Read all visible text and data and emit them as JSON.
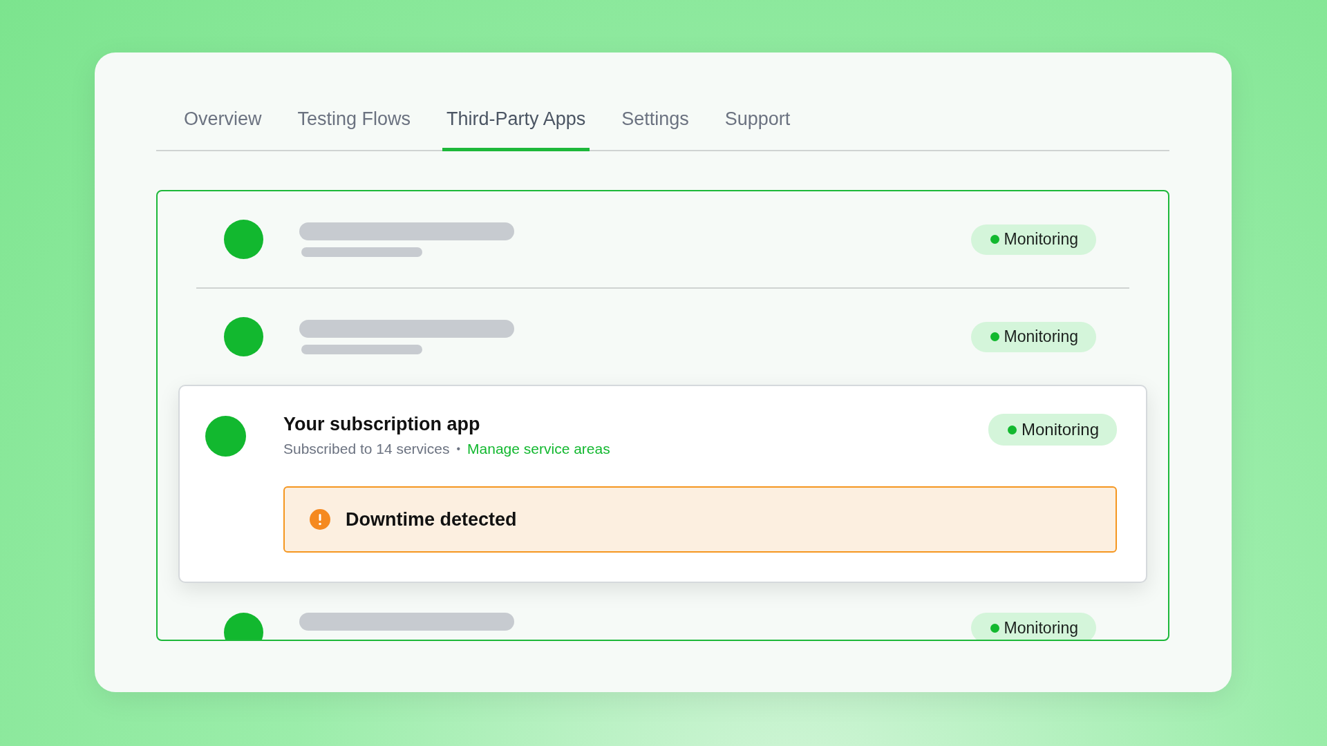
{
  "tabs": [
    {
      "label": "Overview",
      "selected": false
    },
    {
      "label": "Testing Flows",
      "selected": false
    },
    {
      "label": "Third-Party Apps",
      "selected": true
    },
    {
      "label": "Settings",
      "selected": false
    },
    {
      "label": "Support",
      "selected": false
    }
  ],
  "apps": [
    {
      "kind": "skeleton",
      "status": "Monitoring"
    },
    {
      "kind": "skeleton",
      "status": "Monitoring"
    },
    {
      "kind": "app",
      "title": "Your subscription app",
      "subtitle": "Subscribed to 14 services",
      "separator": "•",
      "link": "Manage service areas",
      "status": "Monitoring",
      "alert": "Downtime detected"
    },
    {
      "kind": "skeleton-short",
      "status": "Monitoring"
    }
  ]
}
